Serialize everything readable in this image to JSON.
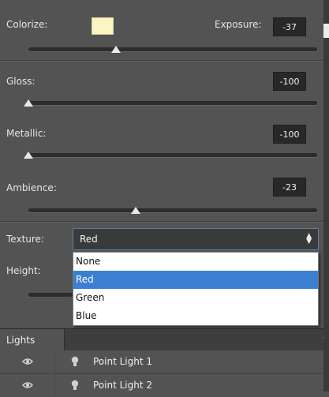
{
  "properties": {
    "colorize_label": "Colorize:",
    "exposure_label": "Exposure:",
    "exposure_value": "-37",
    "colorize_swatch_color": "#fbf5c4",
    "gloss_label": "Gloss:",
    "gloss_value": "-100",
    "metallic_label": "Metallic:",
    "metallic_value": "-100",
    "ambience_label": "Ambience:",
    "ambience_value": "-23",
    "texture_label": "Texture:",
    "texture_selected": "Red",
    "height_label": "Height:"
  },
  "texture_options": [
    "None",
    "Red",
    "Green",
    "Blue"
  ],
  "lights": {
    "tab_label": "Lights",
    "items": [
      {
        "name": "Point Light 1"
      },
      {
        "name": "Point Light 2"
      }
    ]
  },
  "icons": {
    "visibility": "eye-icon",
    "light": "lightbulb-icon",
    "select_arrow": "up-down-arrows-icon",
    "panel_menu": "chevron-down-icon"
  }
}
